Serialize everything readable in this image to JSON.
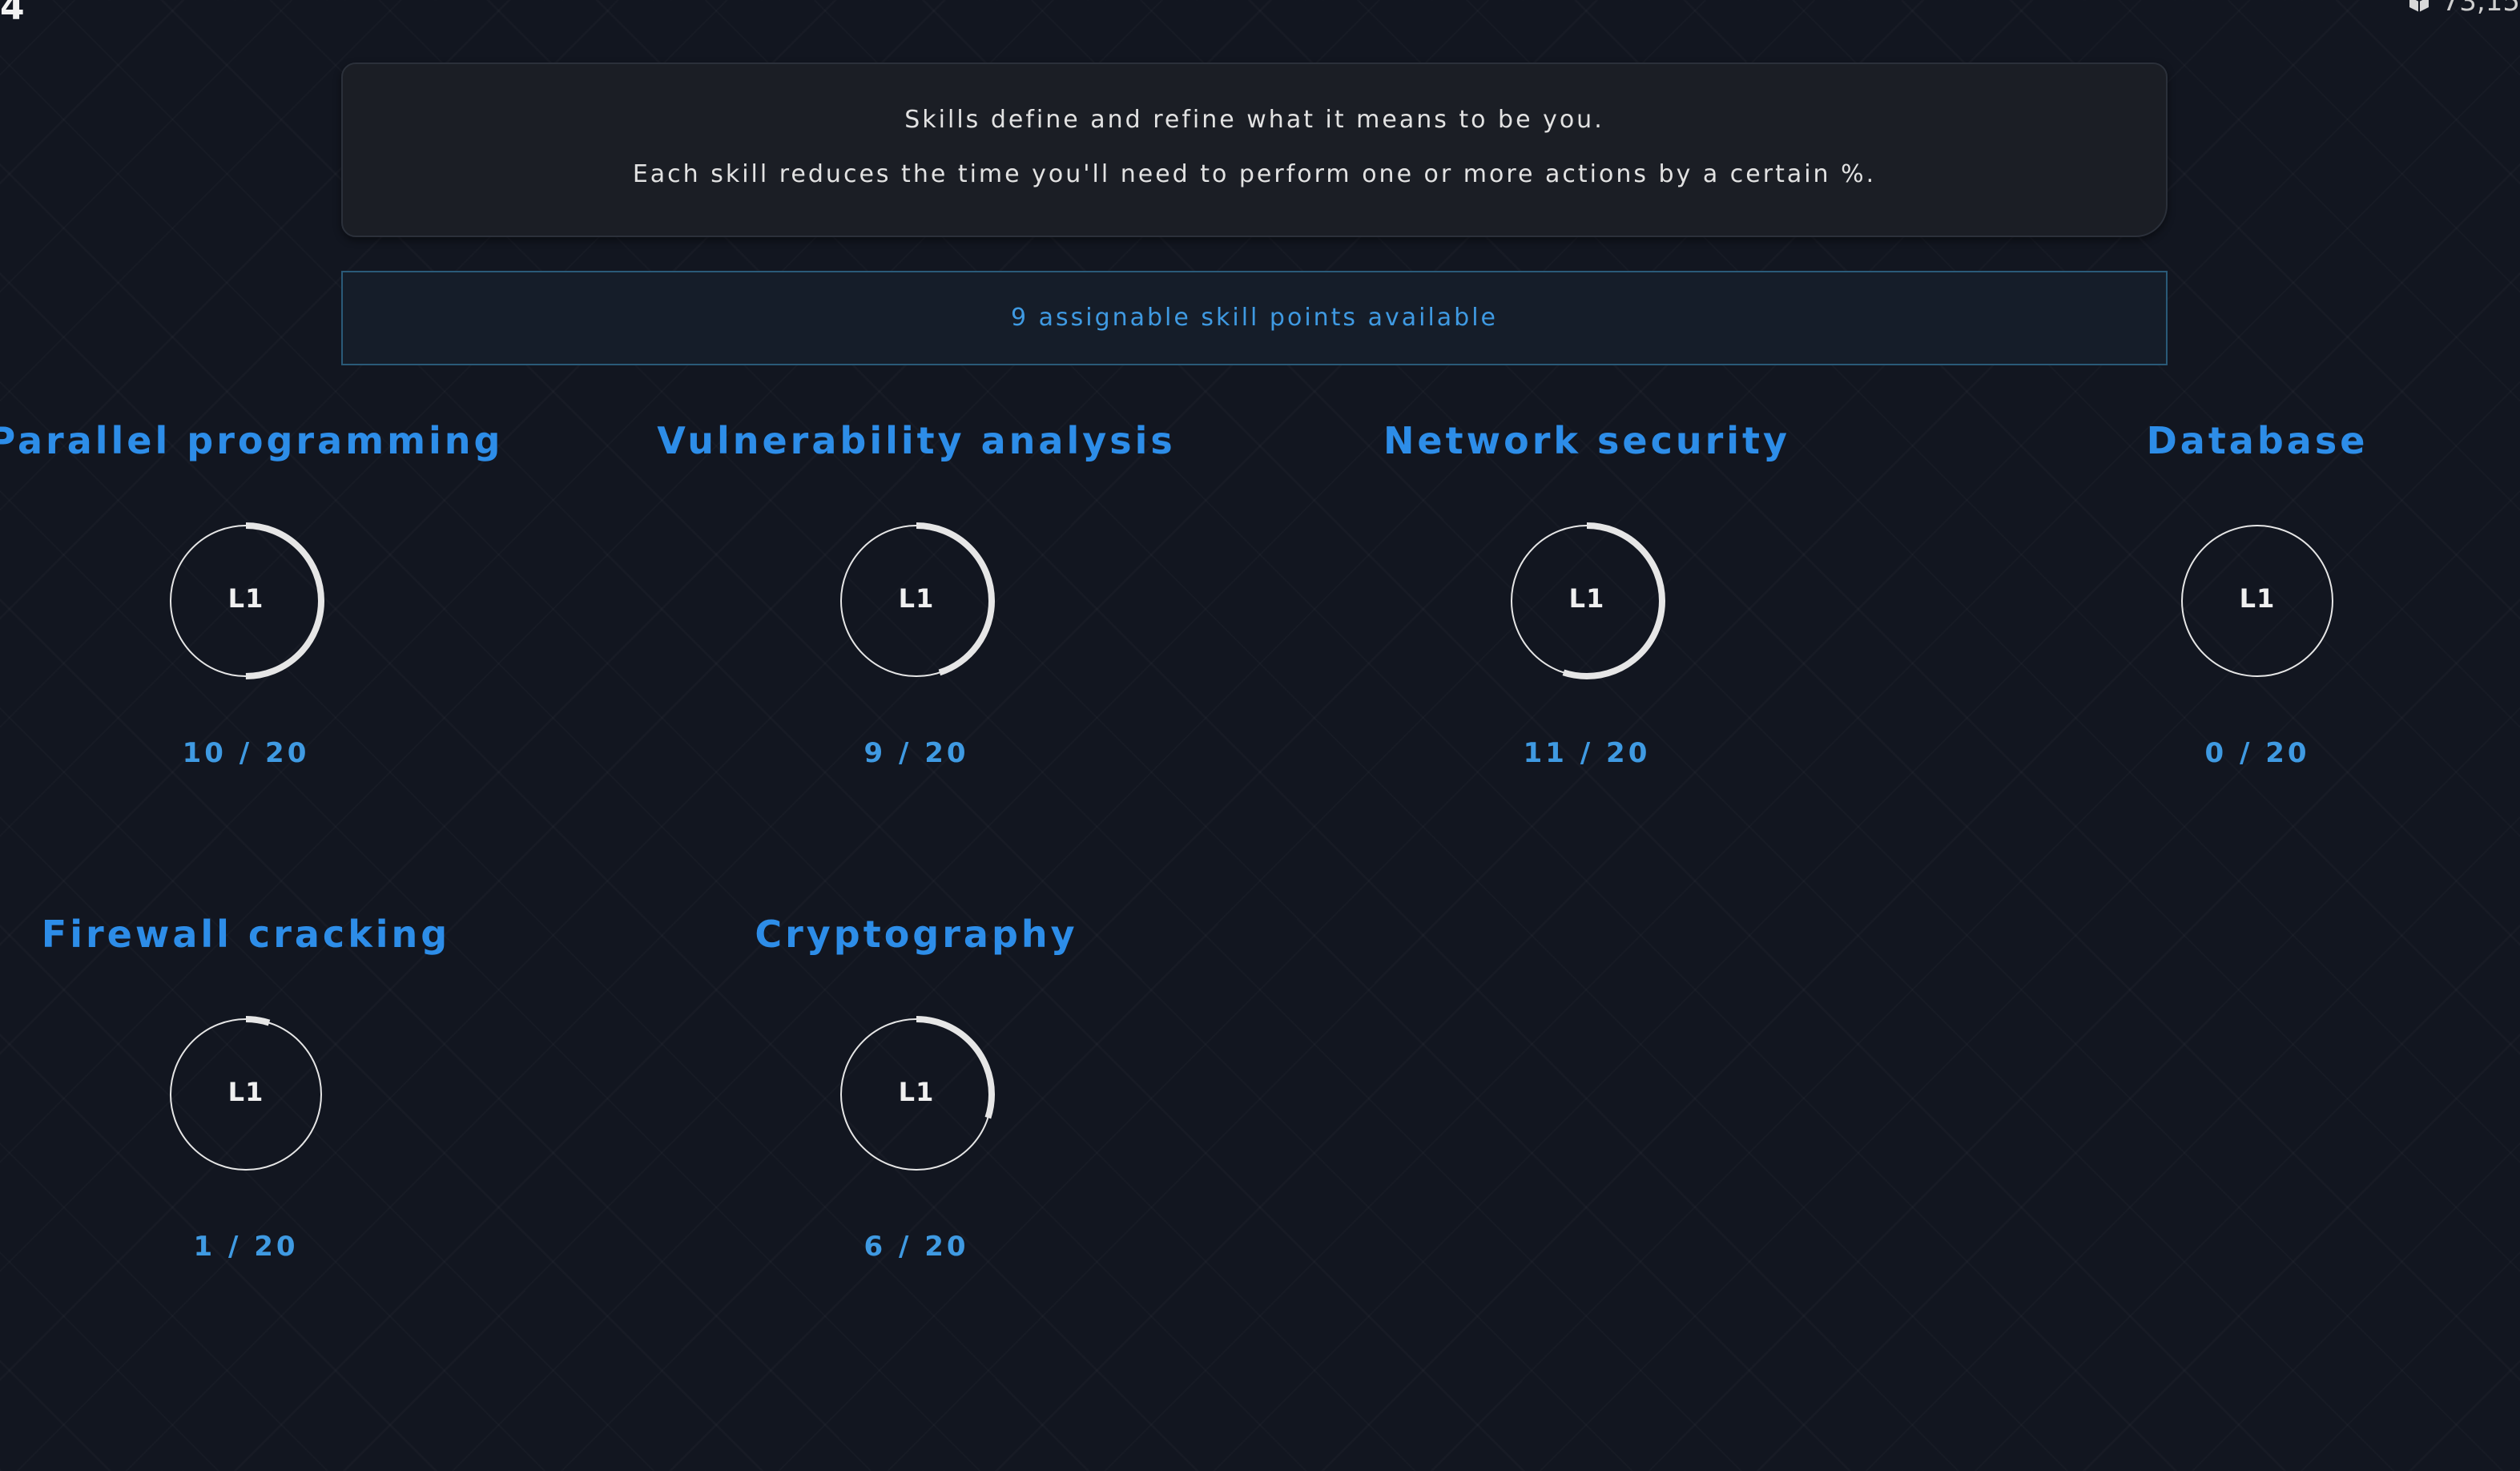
{
  "corner": {
    "left_text": "4",
    "right_text": "73,15",
    "right_icon": "cube-icon"
  },
  "info": {
    "line1": "Skills define and refine what it means to be you.",
    "line2": "Each skill reduces the time you'll need to perform one or more actions by a certain %."
  },
  "points": {
    "label": "9 assignable skill points available"
  },
  "colors": {
    "accent": "#2d8de8",
    "ring": "#e6e6e6",
    "background": "#121620"
  },
  "skills": [
    {
      "name": "Parallel programming",
      "level": "L1",
      "progress": "10 / 20",
      "value": 10,
      "max": 20
    },
    {
      "name": "Vulnerability analysis",
      "level": "L1",
      "progress": "9 / 20",
      "value": 9,
      "max": 20
    },
    {
      "name": "Network security",
      "level": "L1",
      "progress": "11 / 20",
      "value": 11,
      "max": 20
    },
    {
      "name": "Database",
      "level": "L1",
      "progress": "0 / 20",
      "value": 0,
      "max": 20
    },
    {
      "name": "Firewall cracking",
      "level": "L1",
      "progress": "1 / 20",
      "value": 1,
      "max": 20
    },
    {
      "name": "Cryptography",
      "level": "L1",
      "progress": "6 / 20",
      "value": 6,
      "max": 20
    }
  ]
}
